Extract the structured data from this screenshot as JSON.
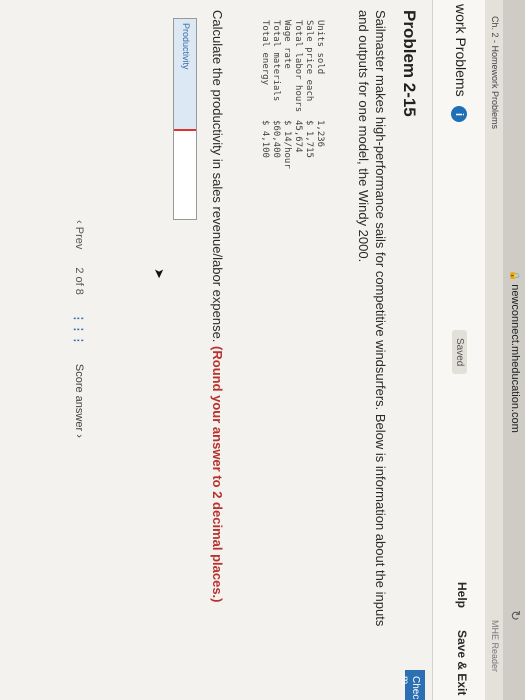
{
  "browser": {
    "url": "newconnect.mheducation.com",
    "tab_title": "Ch. 2 - Homework Problems",
    "reader_label": "MHE Reader"
  },
  "header": {
    "assignment_title": "work Problems",
    "saved_label": "Saved",
    "help_label": "Help",
    "save_exit_label": "Save & Exit",
    "check_label": "Check m"
  },
  "problem": {
    "title": "Problem 2-15",
    "intro": "Sailmaster makes high-performance sails for competitive windsurfers. Below is information about the inputs and outputs for one model, the Windy 2000.",
    "data": [
      {
        "label": "Units sold",
        "value": "1,236"
      },
      {
        "label": "Sale price each",
        "value": "$ 1,715"
      },
      {
        "label": "Total labor hours",
        "value": "45,674"
      },
      {
        "label": "Wage rate",
        "value": "$    14/hour"
      },
      {
        "label": "Total materials",
        "value": "$60,400"
      },
      {
        "label": "Total energy",
        "value": "$ 4,100"
      }
    ],
    "question": "Calculate the productivity in sales revenue/labor expense.",
    "round_note": "(Round your answer to 2 decimal places.)",
    "answer_label": "Productivity",
    "answer_value": ""
  },
  "footer": {
    "prev_label": "Prev",
    "page_indicator": "2 of 8",
    "score_label": "Score answer"
  }
}
